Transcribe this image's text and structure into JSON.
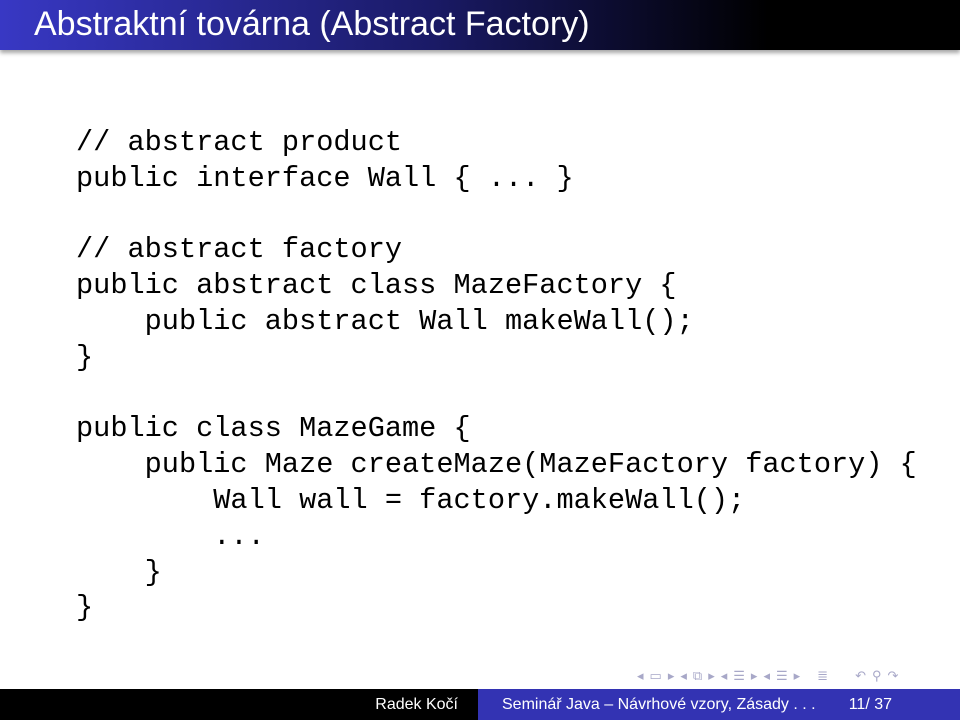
{
  "slide": {
    "title": "Abstraktní továrna (Abstract Factory)",
    "code": "// abstract product\npublic interface Wall { ... }\n\n// abstract factory\npublic abstract class MazeFactory {\n    public abstract Wall makeWall();\n}\n\npublic class MazeGame {\n    public Maze createMaze(MazeFactory factory) {\n        Wall wall = factory.makeWall();\n        ...\n    }\n}"
  },
  "navigation": {
    "icons": [
      "arrow-left",
      "frame",
      "arrow-right",
      "arrow-left",
      "subsection",
      "arrow-right",
      "arrow-left",
      "section",
      "arrow-right",
      "arrow-left",
      "section",
      "arrow-right",
      "align",
      "undo",
      "search",
      "redo"
    ]
  },
  "footer": {
    "author": "Radek Kočí",
    "title": "Seminář Java – Návrhové vzory, Zásady . . .",
    "page": "11/ 37"
  },
  "colors": {
    "title_bg_start": "#3838c4",
    "title_bg_end": "#000000",
    "footer_left": "#000000",
    "footer_right": "#3333b3"
  }
}
